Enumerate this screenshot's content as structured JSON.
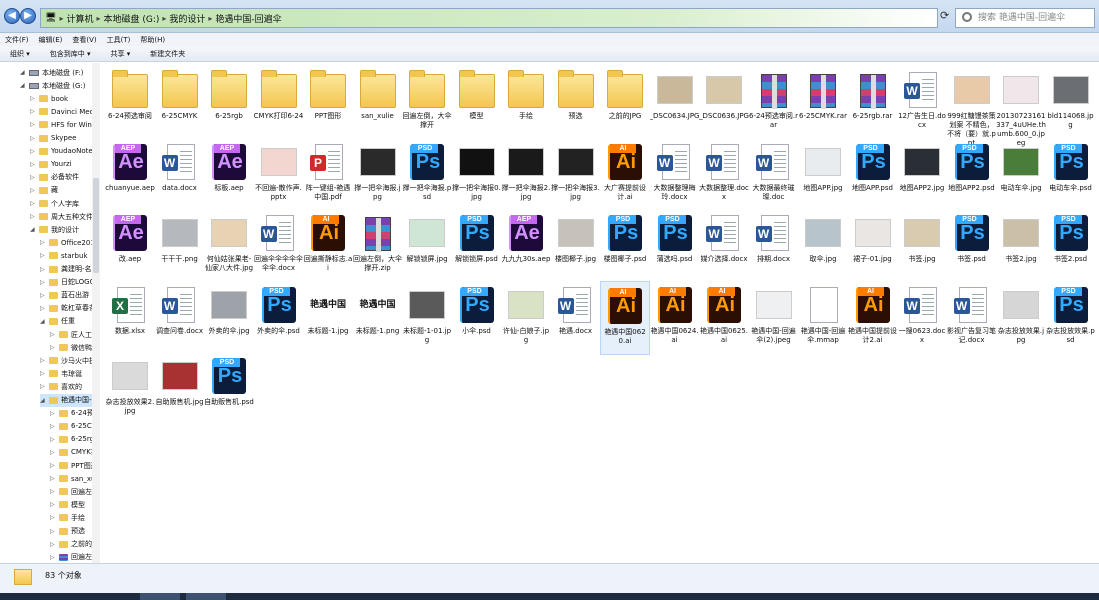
{
  "address": {
    "crumbs": [
      "计算机",
      "本地磁盘 (G:)",
      "我的设计",
      "艳遇中国-回遍伞"
    ]
  },
  "search": {
    "placeholder": "搜索 艳遇中国-回遍伞"
  },
  "menu": [
    "文件(F)",
    "编辑(E)",
    "查看(V)",
    "工具(T)",
    "帮助(H)"
  ],
  "toolbar": [
    "组织 ▾",
    "包含到库中 ▾",
    "共享 ▾",
    "新建文件夹"
  ],
  "sidebar": [
    {
      "label": "本地磁盘 (F:)",
      "icon": "drive",
      "indent": 0
    },
    {
      "label": "本地磁盘 (G:)",
      "icon": "drive",
      "indent": 0
    },
    {
      "label": "book",
      "icon": "folder",
      "indent": 1
    },
    {
      "label": "Davinci Media",
      "icon": "folder",
      "indent": 1
    },
    {
      "label": "HFS  for Windo",
      "icon": "folder",
      "indent": 1
    },
    {
      "label": "Skypee",
      "icon": "folder",
      "indent": 1
    },
    {
      "label": "YoudaoNote",
      "icon": "folder",
      "indent": 1
    },
    {
      "label": "Yourzi",
      "icon": "folder",
      "indent": 1
    },
    {
      "label": "必备软件",
      "icon": "folder",
      "indent": 1
    },
    {
      "label": "藏",
      "icon": "folder",
      "indent": 1
    },
    {
      "label": "个人字库",
      "icon": "folder",
      "indent": 1
    },
    {
      "label": "周大五种文件格",
      "icon": "folder",
      "indent": 1
    },
    {
      "label": "我的设计",
      "icon": "folder",
      "indent": 1
    },
    {
      "label": "Office2016",
      "icon": "folder",
      "indent": 2
    },
    {
      "label": "starbuk",
      "icon": "folder",
      "indent": 2
    },
    {
      "label": "龚建明-名片",
      "icon": "folder",
      "indent": 2
    },
    {
      "label": "日蛇LOGO",
      "icon": "folder",
      "indent": 2
    },
    {
      "label": "蓝石出游",
      "icon": "folder",
      "indent": 2
    },
    {
      "label": "乾杠草春茶",
      "icon": "folder",
      "indent": 2
    },
    {
      "label": "任重",
      "icon": "folder",
      "indent": 2
    },
    {
      "label": "匠人工坊",
      "icon": "folder",
      "indent": 3
    },
    {
      "label": "微信鸭",
      "icon": "folder",
      "indent": 3
    },
    {
      "label": "沙马火中折出绝",
      "icon": "folder",
      "indent": 2
    },
    {
      "label": "韦琼诞",
      "icon": "folder",
      "indent": 2
    },
    {
      "label": "喜欢的",
      "icon": "folder",
      "indent": 2
    },
    {
      "label": "艳遇中国-回遍",
      "icon": "folder",
      "indent": 2,
      "selected": true
    },
    {
      "label": "6-24预览审阅",
      "icon": "folder",
      "indent": 3
    },
    {
      "label": "6-25CMYK",
      "icon": "folder",
      "indent": 3
    },
    {
      "label": "6-25rgb",
      "icon": "folder",
      "indent": 3
    },
    {
      "label": "CMYK打印6",
      "icon": "folder",
      "indent": 3
    },
    {
      "label": "PPT图形",
      "icon": "folder",
      "indent": 3
    },
    {
      "label": "san_xulie",
      "icon": "folder",
      "indent": 3
    },
    {
      "label": "回遍左倒，大",
      "icon": "folder",
      "indent": 3
    },
    {
      "label": "模型",
      "icon": "folder",
      "indent": 3
    },
    {
      "label": "手绘",
      "icon": "folder",
      "indent": 3
    },
    {
      "label": "预选",
      "icon": "folder",
      "indent": 3
    },
    {
      "label": "之前的JPG",
      "icon": "folder",
      "indent": 3
    },
    {
      "label": "回遍左倒，大",
      "icon": "rar",
      "indent": 3
    }
  ],
  "files": [
    {
      "name": "6-24预选审阅",
      "type": "folder"
    },
    {
      "name": "6-25CMYK",
      "type": "folder"
    },
    {
      "name": "6-25rgb",
      "type": "folder"
    },
    {
      "name": "CMYK打印6-24",
      "type": "folder"
    },
    {
      "name": "PPT图形",
      "type": "folder"
    },
    {
      "name": "san_xulie",
      "type": "folder"
    },
    {
      "name": "回遍左倒，大伞撑开",
      "type": "folder"
    },
    {
      "name": "模型",
      "type": "folder"
    },
    {
      "name": "手绘",
      "type": "folder"
    },
    {
      "name": "预选",
      "type": "folder"
    },
    {
      "name": "之前的JPG",
      "type": "folder"
    },
    {
      "name": "_DSC0634.JPG",
      "type": "img",
      "color": "#c9b89a"
    },
    {
      "name": "_DSC0636.JPG",
      "type": "img",
      "color": "#d8c8aa"
    },
    {
      "name": "6-24预选审阅.rar",
      "type": "rar"
    },
    {
      "name": "6-25CMYK.rar",
      "type": "rar"
    },
    {
      "name": "6-25rgb.rar",
      "type": "rar"
    },
    {
      "name": "12广告生日.docx",
      "type": "doc",
      "letter": "W",
      "color": "#2b5797"
    },
    {
      "name": "999红糖馒茶策划案 不精色，不将（要）就.ppt",
      "type": "img",
      "color": "#e8c9a8"
    },
    {
      "name": "20130723161337_4uUHe.thumb.600_0.jpeg",
      "type": "img",
      "color": "#f1e6ea"
    },
    {
      "name": "bld114068.jpg",
      "type": "img",
      "color": "#6b6e72"
    },
    {
      "name": "chuanyue.aep",
      "type": "ae"
    },
    {
      "name": "data.docx",
      "type": "doc",
      "letter": "W",
      "color": "#2b5797"
    },
    {
      "name": "标板.aep",
      "type": "ae"
    },
    {
      "name": "不回遍-散作声.pptx",
      "type": "img",
      "color": "#f4d6d0"
    },
    {
      "name": "阵一键组-艳遇中国.pdf",
      "type": "doc",
      "letter": "P",
      "color": "#d12a2a"
    },
    {
      "name": "撑一把伞海报.jpg",
      "type": "img",
      "color": "#2a2a2a"
    },
    {
      "name": "撑一把伞海报.psd",
      "type": "ps"
    },
    {
      "name": "撑一把伞海报0.jpg",
      "type": "img",
      "color": "#111"
    },
    {
      "name": "撑一把伞海报2.jpg",
      "type": "img",
      "color": "#1a1a1a"
    },
    {
      "name": "撑一把伞海报3.jpg",
      "type": "img",
      "color": "#222"
    },
    {
      "name": "大广赛提前设计.ai",
      "type": "ai"
    },
    {
      "name": "大数据整理梅玲.docx",
      "type": "doc",
      "letter": "W",
      "color": "#2b5797"
    },
    {
      "name": "大数据整理.docx",
      "type": "doc",
      "letter": "W",
      "color": "#2b5797"
    },
    {
      "name": "大数据最终璀璨.doc",
      "type": "doc",
      "letter": "W",
      "color": "#2b5797"
    },
    {
      "name": "地图APP.jpg",
      "type": "img",
      "color": "#e8ecef"
    },
    {
      "name": "地图APP.psd",
      "type": "ps"
    },
    {
      "name": "地图APP2.jpg",
      "type": "img",
      "color": "#2a2f35"
    },
    {
      "name": "地图APP2.psd",
      "type": "ps"
    },
    {
      "name": "电动车伞.jpg",
      "type": "img",
      "color": "#4a7c3a"
    },
    {
      "name": "电动车伞.psd",
      "type": "ps"
    },
    {
      "name": "改.aep",
      "type": "ae"
    },
    {
      "name": "干干干.png",
      "type": "img",
      "color": "#b5b9bd"
    },
    {
      "name": "何仙姑张果老-仙家八大件.jpg",
      "type": "img",
      "color": "#e7d3b3"
    },
    {
      "name": "回遍伞伞伞伞伞伞伞.docx",
      "type": "doc",
      "letter": "W",
      "color": "#2b5797"
    },
    {
      "name": "回遍撕静标志.ai",
      "type": "ai"
    },
    {
      "name": "回遍左倒，大伞撑开.zip",
      "type": "rar"
    },
    {
      "name": "解锁锁屏.jpg",
      "type": "img",
      "color": "#cfe6d4"
    },
    {
      "name": "解锁锁屏.psd",
      "type": "ps"
    },
    {
      "name": "九九九30s.aep",
      "type": "ae"
    },
    {
      "name": "楼图椰子.jpg",
      "type": "img",
      "color": "#c7c2b9"
    },
    {
      "name": "楼图椰子.psd",
      "type": "ps"
    },
    {
      "name": "蒲选吗.psd",
      "type": "ps"
    },
    {
      "name": "媒介选择.docx",
      "type": "doc",
      "letter": "W",
      "color": "#2b5797"
    },
    {
      "name": "排期.docx",
      "type": "doc",
      "letter": "W",
      "color": "#2b5797"
    },
    {
      "name": "取伞.jpg",
      "type": "img",
      "color": "#b8c4cc"
    },
    {
      "name": "裙子-01.jpg",
      "type": "img",
      "color": "#e9e6e3"
    },
    {
      "name": "书签.jpg",
      "type": "img",
      "color": "#d9cbb0"
    },
    {
      "name": "书签.psd",
      "type": "ps"
    },
    {
      "name": "书签2.jpg",
      "type": "img",
      "color": "#cbbfa7"
    },
    {
      "name": "书签2.psd",
      "type": "ps"
    },
    {
      "name": "数据.xlsx",
      "type": "doc",
      "letter": "X",
      "color": "#1e7145"
    },
    {
      "name": "调查问卷.docx",
      "type": "doc",
      "letter": "W",
      "color": "#2b5797"
    },
    {
      "name": "外卖的伞.jpg",
      "type": "img",
      "color": "#9da3a8"
    },
    {
      "name": "外卖的伞.psd",
      "type": "ps"
    },
    {
      "name": "未标题-1.jpg",
      "type": "text",
      "glyph": "艳遇中国"
    },
    {
      "name": "未标题-1.png",
      "type": "text",
      "glyph": "艳遇中国"
    },
    {
      "name": "未标题-1-01.jpg",
      "type": "img",
      "color": "#5a5a5a"
    },
    {
      "name": "小伞.psd",
      "type": "ps"
    },
    {
      "name": "许仙-白娘子.jpg",
      "type": "img",
      "color": "#d9e2c5"
    },
    {
      "name": "艳遇.docx",
      "type": "doc",
      "letter": "W",
      "color": "#2b5797"
    },
    {
      "name": "艳遇中国0620.ai",
      "type": "ai",
      "selected": true
    },
    {
      "name": "艳遇中国0624.ai",
      "type": "ai"
    },
    {
      "name": "艳遇中国0625.ai",
      "type": "ai"
    },
    {
      "name": "艳遇中国-回遍伞(2).jpeg",
      "type": "img",
      "color": "#eef0f2"
    },
    {
      "name": "艳遇中国-回遍伞.mmap",
      "type": "blank"
    },
    {
      "name": "艳遇中国提前设计2.ai",
      "type": "ai"
    },
    {
      "name": "一搜0623.docx",
      "type": "doc",
      "letter": "W",
      "color": "#2b5797"
    },
    {
      "name": "影视广告复习笔记.docx",
      "type": "doc",
      "letter": "W",
      "color": "#2b5797"
    },
    {
      "name": "杂志投放效果.jpg",
      "type": "img",
      "color": "#d6d6d6"
    },
    {
      "name": "杂志投放效果.psd",
      "type": "ps"
    },
    {
      "name": "杂志投放效果2.jpg",
      "type": "img",
      "color": "#dadada"
    },
    {
      "name": "自助贩售机.jpg",
      "type": "img",
      "color": "#a83232"
    },
    {
      "name": "自助贩售机.psd",
      "type": "ps"
    }
  ],
  "status": {
    "count_text": "83 个对象"
  }
}
